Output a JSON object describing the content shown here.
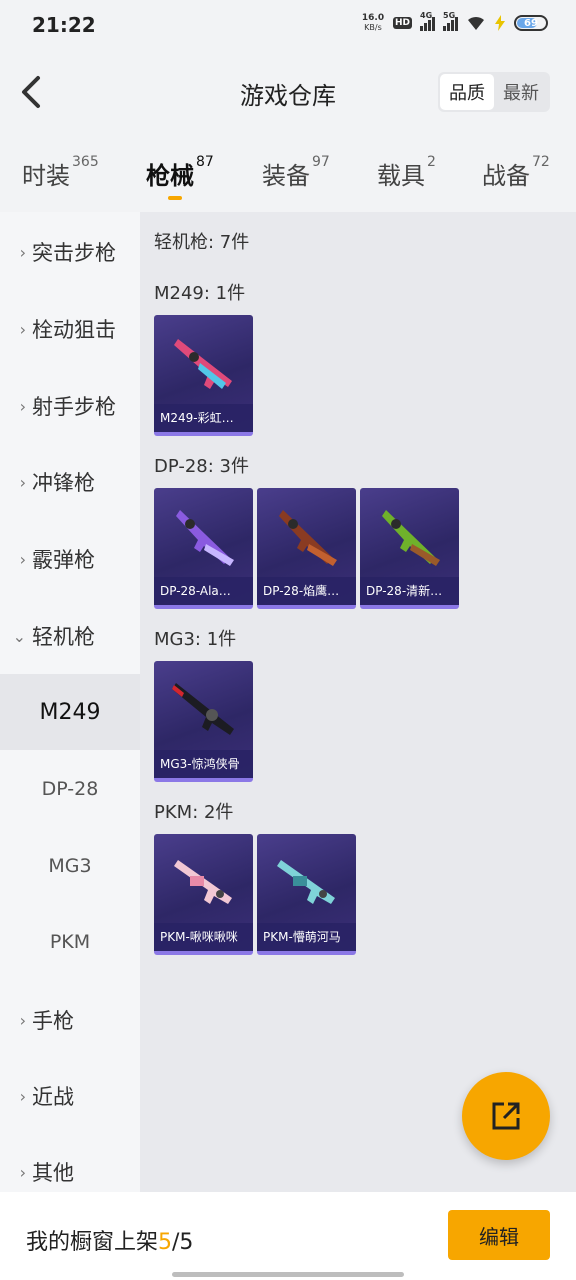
{
  "status_bar": {
    "time": "21:22",
    "net_speed": "16.0",
    "net_unit": "KB/s",
    "hd": "HD",
    "sig1": "4G",
    "sig2": "5G",
    "battery": "69"
  },
  "header": {
    "title": "游戏仓库",
    "sort_options": [
      "品质",
      "最新"
    ]
  },
  "tabs": [
    {
      "label": "时装",
      "count": "365"
    },
    {
      "label": "枪械",
      "count": "87"
    },
    {
      "label": "装备",
      "count": "97"
    },
    {
      "label": "载具",
      "count": "2"
    },
    {
      "label": "战备",
      "count": "72"
    }
  ],
  "sidebar": {
    "items": [
      "突击步枪",
      "栓动狙击",
      "射手步枪",
      "冲锋枪",
      "霰弹枪",
      "轻机枪"
    ],
    "sub_items": [
      "M249",
      "DP-28",
      "MG3",
      "PKM"
    ],
    "items_after": [
      "手枪",
      "近战",
      "其他"
    ]
  },
  "content": {
    "category_title": "轻机枪: 7件",
    "groups": [
      {
        "title": "M249: 1件",
        "cards": [
          "M249-彩虹…"
        ]
      },
      {
        "title": "DP-28: 3件",
        "cards": [
          "DP-28-Ala…",
          "DP-28-焰鹰…",
          "DP-28-清新…"
        ]
      },
      {
        "title": "MG3: 1件",
        "cards": [
          "MG3-惊鸿侠骨"
        ]
      },
      {
        "title": "PKM: 2件",
        "cards": [
          "PKM-啾咪啾咪",
          "PKM-懵萌河马"
        ]
      }
    ]
  },
  "bottom": {
    "text_prefix": "我的橱窗上架",
    "count_current": "5",
    "count_total": "/5",
    "edit_label": "编辑"
  },
  "colors": {
    "accent": "#f7a600",
    "card_bg": "#2e2766",
    "card_border": "#8b78e6"
  },
  "icons": [
    "back-arrow-icon",
    "share-out-icon",
    "wifi-icon",
    "battery-icon"
  ]
}
